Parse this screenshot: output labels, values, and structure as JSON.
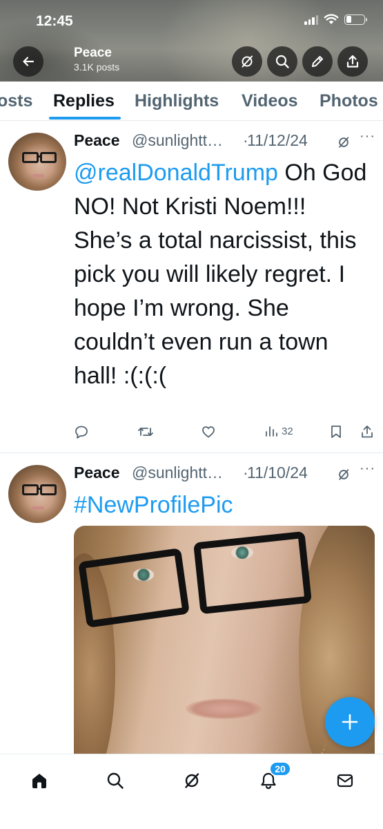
{
  "status_bar": {
    "time": "12:45"
  },
  "header": {
    "name": "Peace",
    "posts_count": "3.1K posts"
  },
  "tabs": [
    {
      "label": "Posts",
      "visible_label": "osts",
      "active": false
    },
    {
      "label": "Replies",
      "active": true
    },
    {
      "label": "Highlights",
      "active": false
    },
    {
      "label": "Videos",
      "active": false
    },
    {
      "label": "Photos",
      "active": false
    }
  ],
  "posts": [
    {
      "name": "Peace",
      "handle": "@sunlightt…",
      "separator": "·",
      "date": "11/12/24",
      "more": "···",
      "mention": "@realDonaldTrump",
      "body": " Oh God NO! Not Kristi Noem!!! She’s a total narcissist, this pick you will likely regret. I hope I’m wrong. She couldn’t even run a town hall! :(:(:(",
      "views": "32"
    },
    {
      "name": "Peace",
      "handle": "@sunlightt…",
      "separator": "·",
      "date": "11/10/24",
      "more": "···",
      "hashtag": "#NewProfilePic"
    }
  ],
  "nav": {
    "notifications_badge": "20"
  },
  "icons": {
    "back": "back-arrow-icon",
    "grok": "grok-icon",
    "search": "search-icon",
    "edit": "pencil-icon",
    "share": "share-icon",
    "reply": "reply-icon",
    "repost": "repost-icon",
    "like": "heart-icon",
    "views": "views-icon",
    "bookmark": "bookmark-icon",
    "home": "home-icon",
    "bell": "bell-icon",
    "mail": "mail-icon",
    "compose": "plus-icon"
  },
  "colors": {
    "accent": "#1d9bf0",
    "text": "#0f1419",
    "secondary": "#536471"
  }
}
